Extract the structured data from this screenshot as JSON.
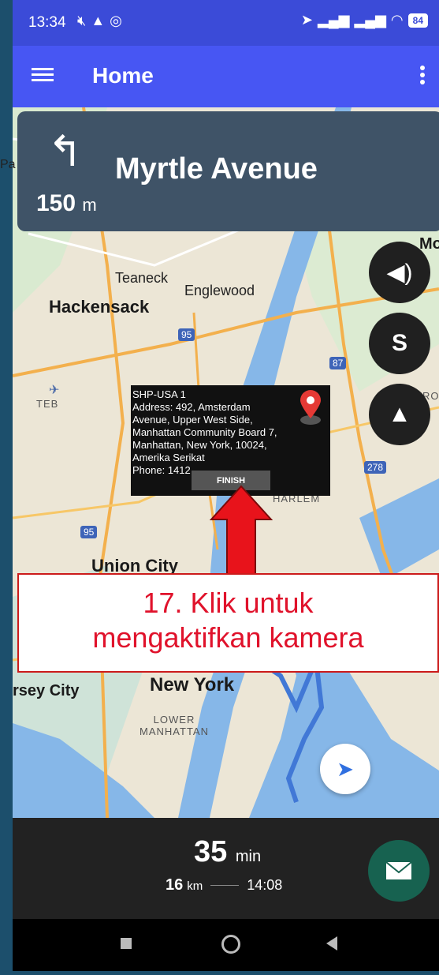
{
  "status_bar": {
    "time": "13:34",
    "left_icons": [
      "mute-icon",
      "navigation-icon",
      "location-icon"
    ],
    "right_icons": [
      "navigation-icon",
      "signal-icon",
      "signal-icon",
      "wifi-icon"
    ],
    "battery": "84"
  },
  "app_bar": {
    "title": "Home",
    "menu_icon": "hamburger-icon",
    "more_icon": "more-vert-icon"
  },
  "navigation": {
    "turn_icon": "turn-left-icon",
    "street": "Myrtle Avenue",
    "distance": "150",
    "distance_unit": "m"
  },
  "map": {
    "places": {
      "teaneck": "Teaneck",
      "englewood": "Englewood",
      "hackensack": "Hackensack",
      "teb": "TEB",
      "union_city": "Union City",
      "new_york": "New York",
      "jersey_city": "rsey City",
      "lower_manhattan": "LOWER MANHATTAN",
      "harlem": "HARLEM",
      "mo": "Mo",
      "ro": "RO",
      "pa": "Pa"
    },
    "shields": {
      "i95_a": "95",
      "i95_b": "95",
      "i87": "87",
      "i278": "278"
    }
  },
  "popup": {
    "lines": [
      "SHP-USA 1",
      "Address: 492, Amsterdam",
      "Avenue, Upper West Side,",
      "Manhattan Community Board 7,",
      "Manhattan, New York, 10024,",
      "Amerika Serikat",
      "Phone: 1412"
    ],
    "finish_label": "FINISH"
  },
  "annotation": {
    "line1": "17. Klik untuk",
    "line2": "mengaktifkan kamera"
  },
  "eta": {
    "minutes": "35",
    "minutes_unit": "min",
    "distance": "16",
    "distance_unit": "km",
    "arrival": "14:08"
  },
  "colors": {
    "status_bar": "#3b4bd8",
    "app_bar": "#4756f3",
    "nav_banner": "#3f5367",
    "mail_button": "#176250",
    "annotation_red": "#e0122b"
  }
}
